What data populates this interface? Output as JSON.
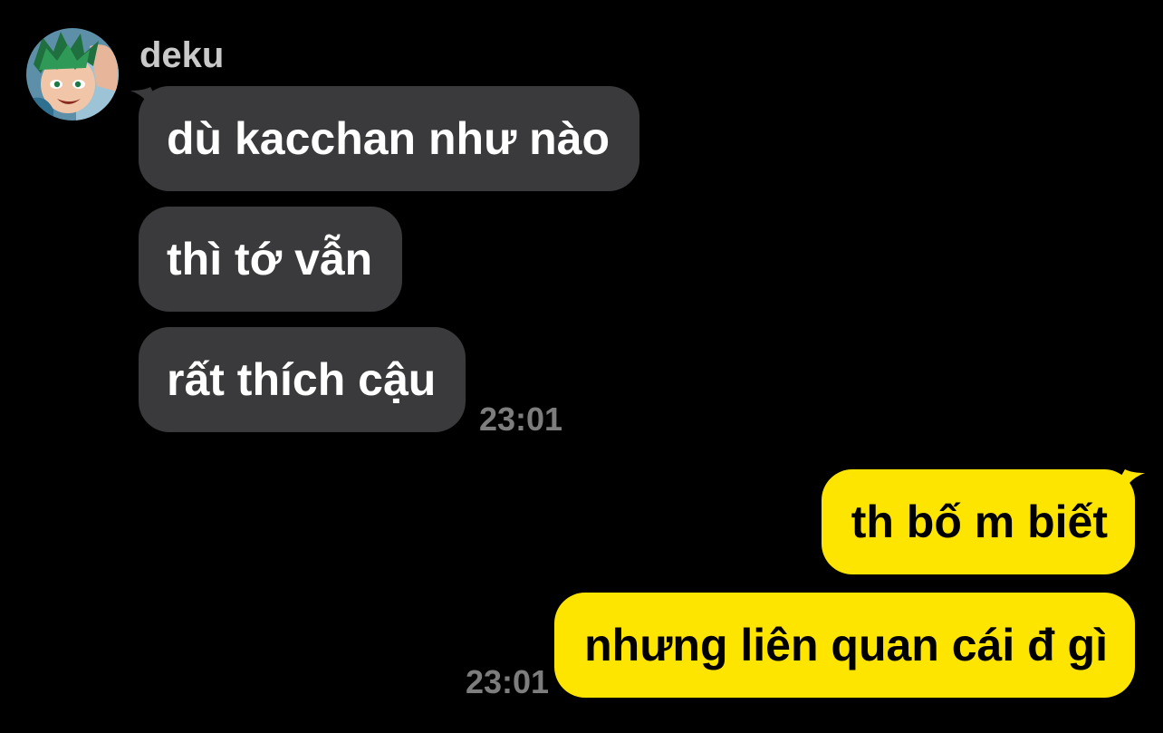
{
  "colors": {
    "background": "#000000",
    "incoming_bubble": "#3a3a3c",
    "incoming_text": "#ffffff",
    "outgoing_bubble": "#fee500",
    "outgoing_text": "#000000",
    "timestamp": "#7d7d7d",
    "sender_name": "#c9c9c9"
  },
  "sender": {
    "name": "deku",
    "avatar": "avatar-image"
  },
  "incoming": {
    "messages": [
      {
        "text": "dù kacchan như nào"
      },
      {
        "text": "thì tớ vẫn"
      },
      {
        "text": "rất thích cậu"
      }
    ],
    "time": "23:01"
  },
  "outgoing": {
    "messages": [
      {
        "text": "th bố m biết"
      },
      {
        "text": "nhưng liên quan cái đ gì"
      }
    ],
    "time": "23:01"
  }
}
